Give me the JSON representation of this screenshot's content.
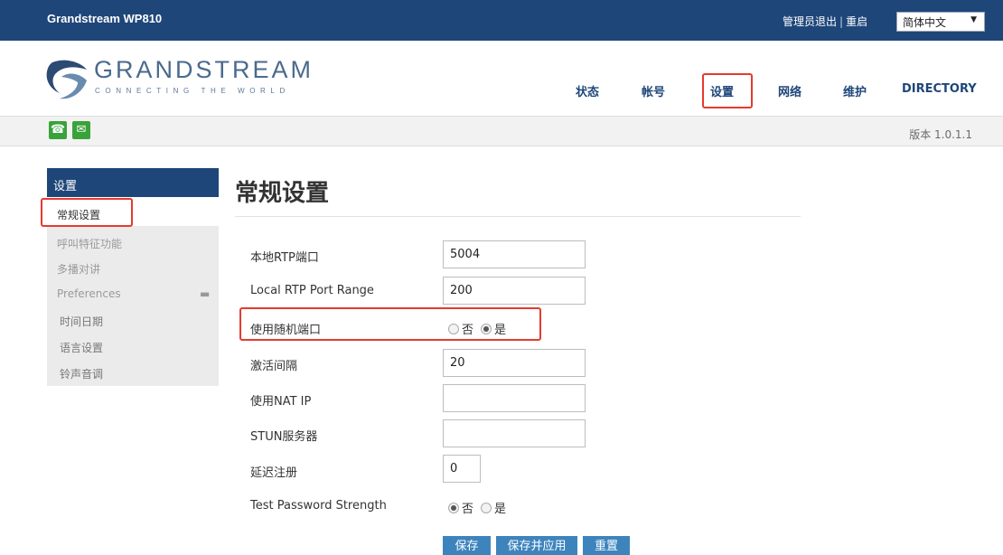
{
  "topbar": {
    "product": "Grandstream WP810",
    "logout": "管理员退出",
    "separator": "|",
    "reboot": "重启",
    "language": "简体中文"
  },
  "logo": {
    "word": "GRANDSTREAM",
    "tagline": "CONNECTING THE WORLD"
  },
  "nav": {
    "items": [
      "状态",
      "帐号",
      "设置",
      "网络",
      "维护",
      "DIRECTORY"
    ],
    "active": "设置"
  },
  "toolbar": {
    "icons": [
      "phone-icon",
      "contact-icon"
    ],
    "version": "版本 1.0.1.1"
  },
  "sidebar": {
    "title": "设置",
    "current": "常规设置",
    "items": [
      "呼叫特征功能",
      "多播对讲",
      "Preferences"
    ],
    "sub_items": [
      "时间日期",
      "语言设置",
      "铃声音调"
    ]
  },
  "main": {
    "title": "常规设置",
    "fields": {
      "local_rtp_port": {
        "label": "本地RTP端口",
        "value": "5004"
      },
      "rtp_port_range": {
        "label": "Local RTP Port Range",
        "value": "200"
      },
      "random_port": {
        "label": "使用随机端口",
        "options": [
          "否",
          "是"
        ],
        "selected": "是"
      },
      "keepalive": {
        "label": "激活间隔",
        "value": "20"
      },
      "nat_ip": {
        "label": "使用NAT IP",
        "value": ""
      },
      "stun_server": {
        "label": "STUN服务器",
        "value": ""
      },
      "delay_register": {
        "label": "延迟注册",
        "value": "0"
      },
      "password_strength": {
        "label": "Test Password Strength",
        "options": [
          "否",
          "是"
        ],
        "selected": "否"
      }
    },
    "buttons": {
      "save": "保存",
      "save_apply": "保存并应用",
      "reset": "重置"
    }
  },
  "colors": {
    "topbar": "#1e4679",
    "highlight": "#e43b2f",
    "button": "#3d84bd",
    "icon_green": "#3aa23a"
  }
}
